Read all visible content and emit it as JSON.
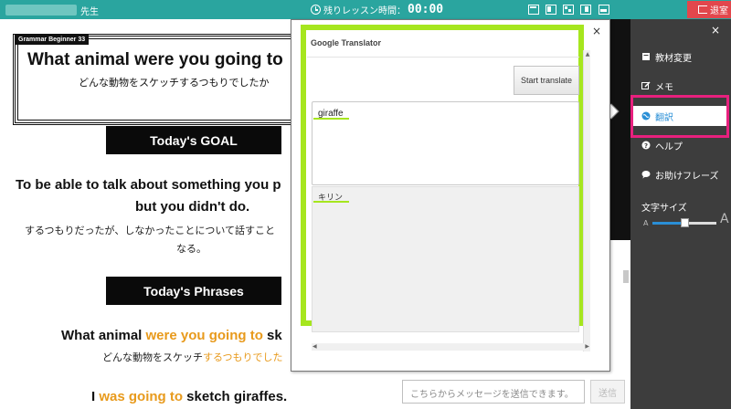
{
  "topbar": {
    "teacher_suffix": "先生",
    "timer_label": "残りレッスン時間：",
    "timer_value": "00:00",
    "exit_label": "退室",
    "accent_color": "#2aa59f",
    "exit_color": "#e2474c"
  },
  "lesson": {
    "material_tag": "Grammar Beginner 33",
    "title": "What animal were you going to",
    "title_ja": "どんな動物をスケッチするつもりでしたか",
    "goal_heading": "Today's GOAL",
    "goal_en_line1": "To be able to talk about something you p",
    "goal_en_line2": "but you didn't do.",
    "goal_ja_line1": "するつもりだったが、しなかったことについて話すこと",
    "goal_ja_line2": "なる。",
    "phrases_heading": "Today's Phrases",
    "phrase1_en_a": "What animal ",
    "phrase1_en_hl": "were you going to",
    "phrase1_en_b": " sk",
    "phrase1_ja_a": "どんな動物をスケッチ",
    "phrase1_ja_hl": "するつもりでした",
    "phrase2_en_a": "I ",
    "phrase2_en_hl": "was going to",
    "phrase2_en_b": " sketch giraffes.",
    "highlight_color": "#e89a1c"
  },
  "chat": {
    "placeholder": "こちらからメッセージを送信できます。",
    "send_label": "送信"
  },
  "sidebar": {
    "close": "×",
    "items": [
      {
        "label": "教材変更",
        "icon": "book-icon"
      },
      {
        "label": "メモ",
        "icon": "edit-icon"
      },
      {
        "label": "翻訳",
        "icon": "globe-icon"
      },
      {
        "label": "ヘルプ",
        "icon": "help-icon"
      },
      {
        "label": "お助けフレーズ",
        "icon": "chat-bubble-icon"
      }
    ],
    "font_size_label": "文字サイズ",
    "font_small": "A",
    "font_large": "A",
    "font_size_level": 0.5,
    "active_color": "#2a8fd6",
    "highlight_outline_color": "#e8207e"
  },
  "translator": {
    "close": "×",
    "title": "Google Translator",
    "button_label": "Start translate",
    "input_value": "giraffe",
    "output_value": "キリン",
    "frame_color": "#a6e61e"
  }
}
